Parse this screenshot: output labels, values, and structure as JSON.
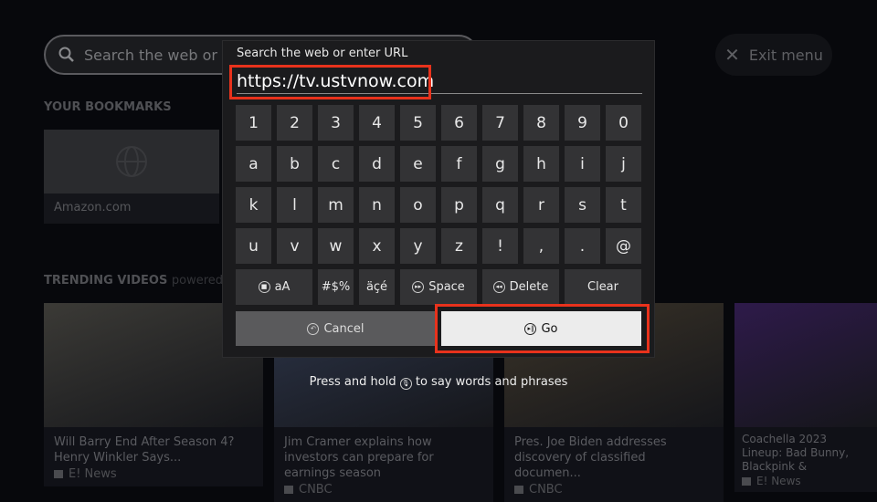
{
  "search_bar": {
    "placeholder": "Search the web or en",
    "icon": "search-icon"
  },
  "exit_menu": {
    "label": "Exit menu",
    "icon": "close-icon"
  },
  "bookmarks": {
    "heading": "YOUR BOOKMARKS",
    "items": [
      {
        "label": "Amazon.com",
        "icon": "globe-icon"
      }
    ]
  },
  "trending": {
    "heading": "TRENDING VIDEOS",
    "powered": "powered by",
    "videos": [
      {
        "title": "Will Barry End After Season 4? Henry Winkler Says...",
        "source": "E! News",
        "thumb": "#3b3a36"
      },
      {
        "title": "Jim Cramer explains how investors can prepare for earnings season",
        "source": "CNBC",
        "thumb": "#2c3448"
      },
      {
        "title": "Pres. Joe Biden addresses discovery of classified documen...",
        "source": "CNBC",
        "thumb": "#3a3328"
      },
      {
        "title": "Coachella 2023 Lineup: Bad Bunny, Blackpink &",
        "source": "E! News",
        "thumb": "#2e1a4a"
      }
    ]
  },
  "dialog": {
    "title": "Search the web or enter URL",
    "input_value": "https://tv.ustvnow.com",
    "rows": [
      [
        "1",
        "2",
        "3",
        "4",
        "5",
        "6",
        "7",
        "8",
        "9",
        "0"
      ],
      [
        "a",
        "b",
        "c",
        "d",
        "e",
        "f",
        "g",
        "h",
        "i",
        "j"
      ],
      [
        "k",
        "l",
        "m",
        "n",
        "o",
        "p",
        "q",
        "r",
        "s",
        "t"
      ],
      [
        "u",
        "v",
        "w",
        "x",
        "y",
        "z",
        "!",
        ",",
        ".",
        "@"
      ]
    ],
    "special": {
      "case": "aA",
      "symbols": "#$%",
      "accents": "äçé",
      "space": "Space",
      "delete": "Delete",
      "clear": "Clear"
    },
    "cancel": "Cancel",
    "go": "Go",
    "hint_before": "Press and hold",
    "hint_after": "to say words and phrases"
  },
  "colors": {
    "highlight": "#e8321c"
  }
}
